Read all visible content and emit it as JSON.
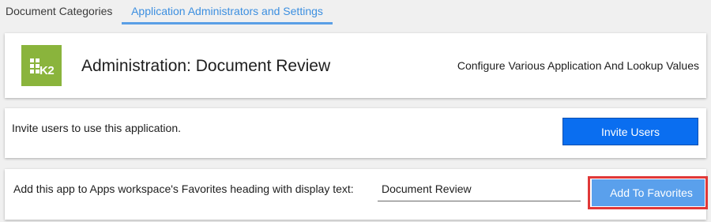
{
  "tabs": [
    {
      "label": "Document Categories"
    },
    {
      "label": "Application Administrators and Settings"
    }
  ],
  "header": {
    "logo_text": "K2",
    "title": "Administration: Document Review",
    "subtitle": "Configure Various Application And Lookup Values"
  },
  "invite": {
    "text": "Invite users to use this application.",
    "button_label": "Invite Users"
  },
  "favorites": {
    "text": "Add this app to Apps workspace's Favorites heading with display text:",
    "input_value": "Document Review",
    "button_label": "Add To Favorites"
  },
  "colors": {
    "brand_green": "#8ab43c",
    "active_tab": "#3c8fe0",
    "primary_button": "#0a6ef0",
    "secondary_button": "#5aa0ec",
    "highlight_outline": "#e03838"
  }
}
